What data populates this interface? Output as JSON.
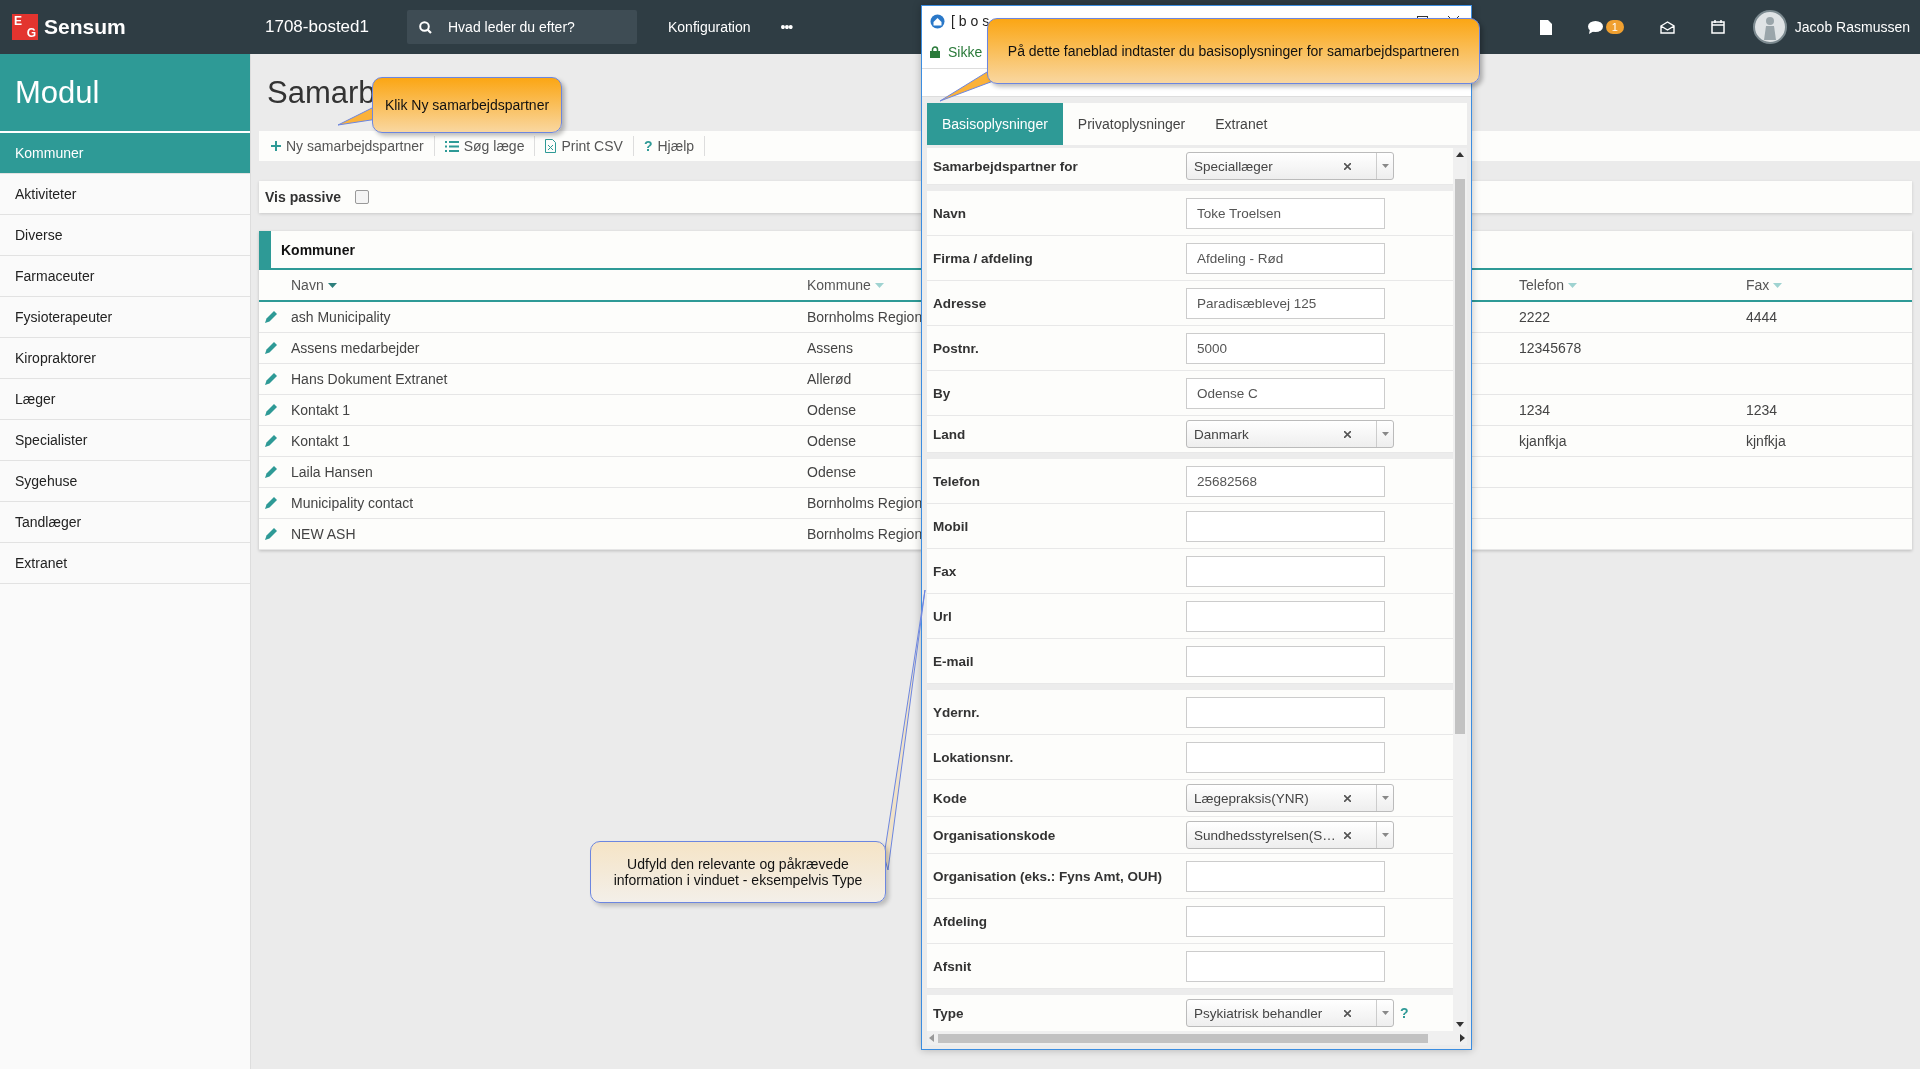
{
  "top_bar": {
    "logo_letters": [
      "E",
      "G"
    ],
    "brand": "Sensum",
    "site": "1708-bosted1",
    "search": {
      "placeholder": "Hvad leder du efter?"
    },
    "menu": "Konfiguration",
    "more": "•••",
    "notification_count": "1",
    "user": "Jacob Rasmussen"
  },
  "sidebar": {
    "title": "Modul",
    "items": [
      {
        "label": "Kommuner",
        "selected": true
      },
      {
        "label": "Aktiviteter",
        "selected": false
      },
      {
        "label": "Diverse",
        "selected": false
      },
      {
        "label": "Farmaceuter",
        "selected": false
      },
      {
        "label": "Fysioterapeuter",
        "selected": false
      },
      {
        "label": "Kiropraktorer",
        "selected": false
      },
      {
        "label": "Læger",
        "selected": false
      },
      {
        "label": "Specialister",
        "selected": false
      },
      {
        "label": "Sygehuse",
        "selected": false
      },
      {
        "label": "Tandlæger",
        "selected": false
      },
      {
        "label": "Extranet",
        "selected": false
      }
    ]
  },
  "page": {
    "title": "Samarb",
    "toolbar": [
      {
        "kind": "add",
        "label": "Ny samarbejdspartner"
      },
      {
        "kind": "list",
        "label": "Søg læge"
      },
      {
        "kind": "csv",
        "label": "Print CSV"
      },
      {
        "kind": "help",
        "label": "Hjælp",
        "symbol": "?"
      }
    ],
    "vis_passive": {
      "label": "Vis passive",
      "checked": false
    },
    "table": {
      "title": "Kommuner",
      "columns": [
        {
          "label": "Navn",
          "sorted": true
        },
        {
          "label": "Kommune",
          "sorted": false
        },
        {
          "label": "Telefon",
          "sorted": false
        },
        {
          "label": "Fax",
          "sorted": false
        }
      ],
      "rows": [
        {
          "navn": "ash Municipality",
          "kommune": "Bornholms Region",
          "telefon": "2222",
          "fax": "4444"
        },
        {
          "navn": "Assens medarbejder",
          "kommune": "Assens",
          "telefon": "12345678",
          "fax": ""
        },
        {
          "navn": "Hans Dokument Extranet",
          "kommune": "Allerød",
          "telefon": "",
          "fax": ""
        },
        {
          "navn": "Kontakt 1",
          "kommune": "Odense",
          "telefon": "1234",
          "fax": "1234"
        },
        {
          "navn": "Kontakt 1",
          "kommune": "Odense",
          "telefon": "kjanfkja",
          "fax": "kjnfkja"
        },
        {
          "navn": "Laila Hansen",
          "kommune": "Odense",
          "telefon": "",
          "fax": ""
        },
        {
          "navn": "Municipality contact",
          "kommune": "Bornholms Region",
          "telefon": "",
          "fax": ""
        },
        {
          "navn": "NEW ASH",
          "kommune": "Bornholms Region",
          "telefon": "",
          "fax": ""
        }
      ]
    }
  },
  "popup": {
    "title": "[ b o s",
    "address": "Sikke",
    "tabs": [
      {
        "label": "Basisoplysninger",
        "selected": true
      },
      {
        "label": "Privatoplysninger",
        "selected": false
      },
      {
        "label": "Extranet",
        "selected": false
      }
    ],
    "groups": [
      {
        "fields": [
          {
            "kind": "select",
            "label": "Samarbejdspartner for",
            "value": "Speciallæger"
          }
        ]
      },
      {
        "fields": [
          {
            "kind": "text",
            "label": "Navn",
            "value": "Toke Troelsen"
          },
          {
            "kind": "text",
            "label": "Firma / afdeling",
            "value": "Afdeling - Rød"
          },
          {
            "kind": "text",
            "label": "Adresse",
            "value": "Paradisæblevej 125"
          },
          {
            "kind": "text",
            "label": "Postnr.",
            "value": "5000"
          },
          {
            "kind": "text",
            "label": "By",
            "value": "Odense C"
          },
          {
            "kind": "select",
            "label": "Land",
            "value": "Danmark"
          }
        ]
      },
      {
        "fields": [
          {
            "kind": "text",
            "label": "Telefon",
            "value": "25682568"
          },
          {
            "kind": "text",
            "label": "Mobil"
          },
          {
            "kind": "text",
            "label": "Fax"
          },
          {
            "kind": "text",
            "label": "Url"
          },
          {
            "kind": "text",
            "label": "E-mail"
          }
        ]
      },
      {
        "fields": [
          {
            "kind": "text",
            "label": "Ydernr."
          },
          {
            "kind": "text",
            "label": "Lokationsnr."
          },
          {
            "kind": "select",
            "label": "Kode",
            "value": "Lægepraksis(YNR)"
          },
          {
            "kind": "select",
            "label": "Organisationskode",
            "value": "Sundhedsstyrelsen(S…"
          },
          {
            "kind": "text",
            "label": "Organisation (eks.: Fyns Amt, OUH)"
          },
          {
            "kind": "text",
            "label": "Afdeling"
          },
          {
            "kind": "text",
            "label": "Afsnit"
          }
        ]
      },
      {
        "fields": [
          {
            "kind": "select",
            "label": "Type",
            "value": "Psykiatrisk behandler",
            "help": "?"
          }
        ]
      }
    ]
  },
  "callouts": [
    {
      "kind": "orange",
      "text": "Klik Ny samarbejdspartner"
    },
    {
      "kind": "orange",
      "text": "På dette faneblad indtaster du basisoplysninger for samarbejdspartneren"
    },
    {
      "kind": "beige",
      "text": "Udfyld den relevante og påkrævede information i vinduet - eksempelvis Type"
    }
  ]
}
